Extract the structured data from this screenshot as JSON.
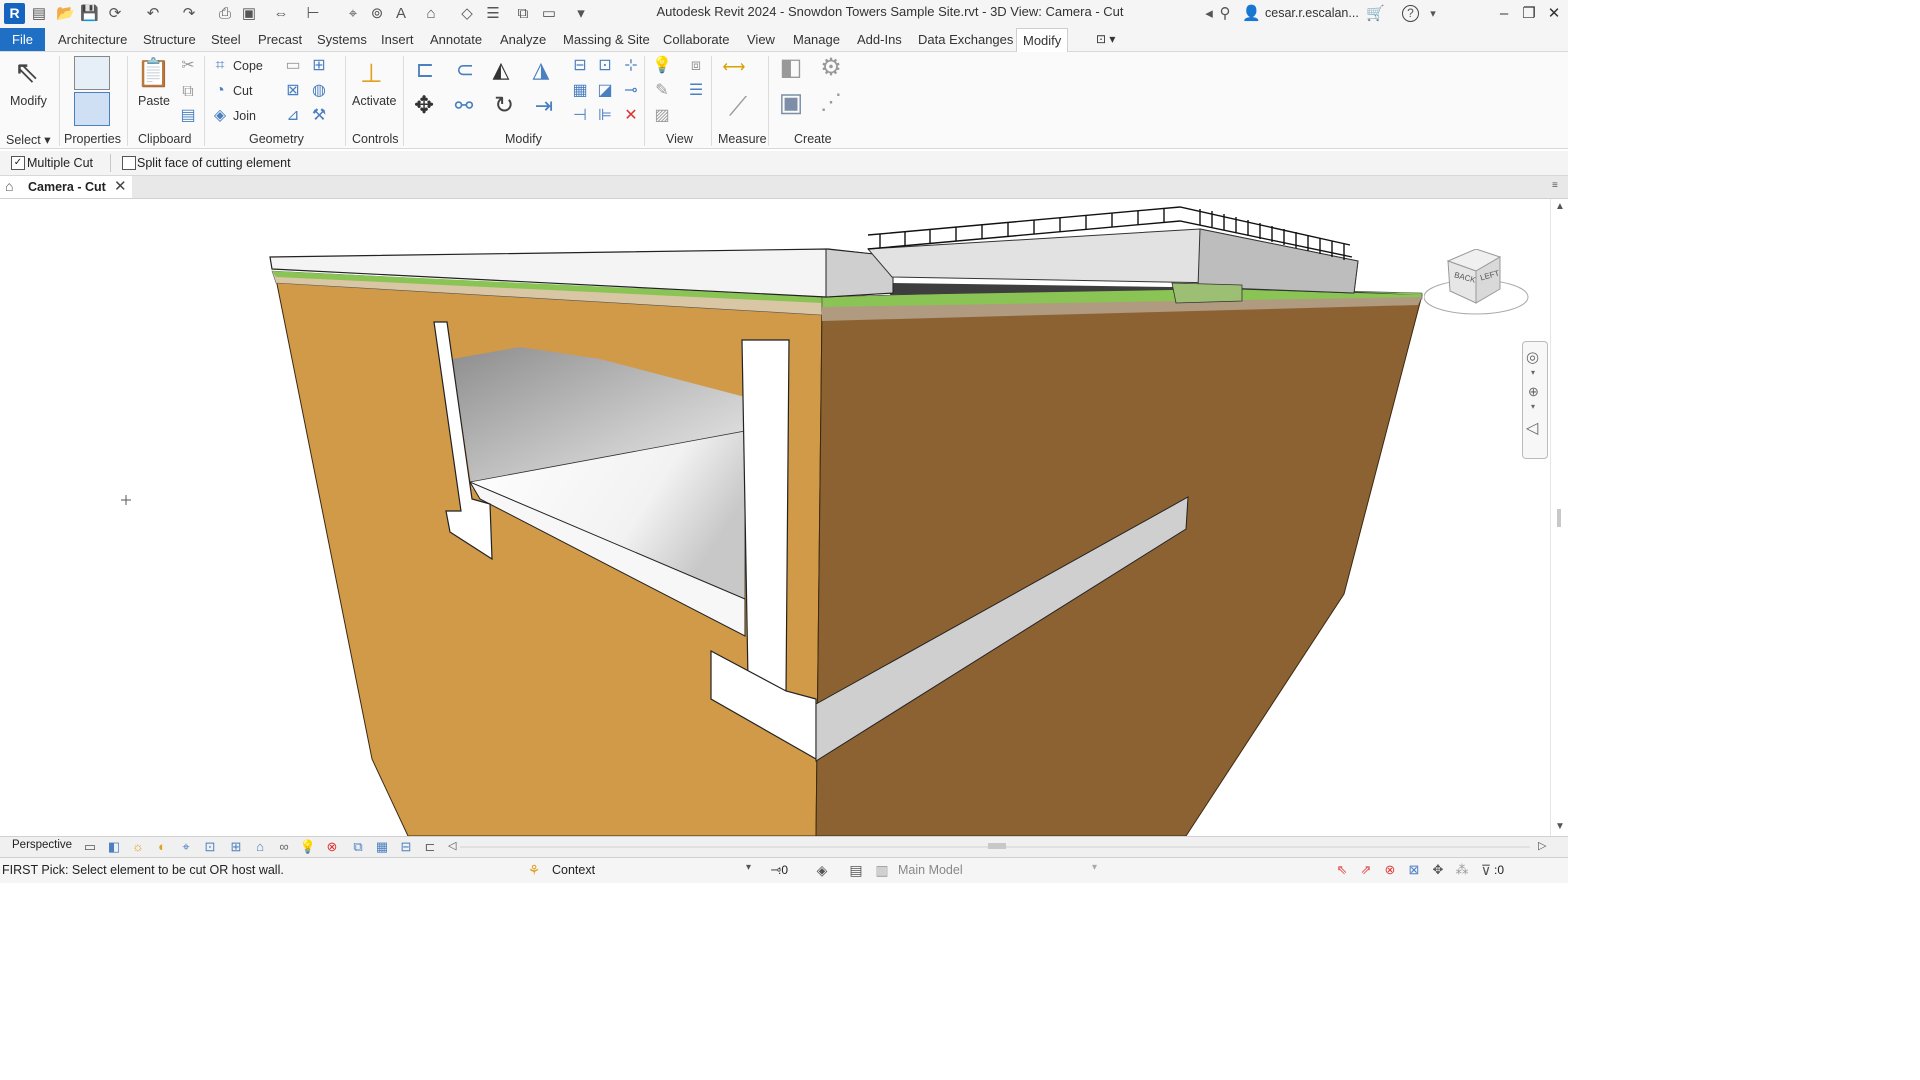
{
  "titlebar": {
    "app_logo": "R",
    "title": "Autodesk Revit 2024 - Snowdon Towers Sample Site.rvt - 3D View: Camera - Cut",
    "user": "cesar.r.escalan...",
    "help": "?"
  },
  "tabs": [
    "File",
    "Architecture",
    "Structure",
    "Steel",
    "Precast",
    "Systems",
    "Insert",
    "Annotate",
    "Analyze",
    "Massing & Site",
    "Collaborate",
    "View",
    "Manage",
    "Add-Ins",
    "Data Exchanges",
    "Modify"
  ],
  "active_tab": "Modify",
  "ribbon": {
    "modify_label": "Modify",
    "paste_label": "Paste",
    "cope_label": "Cope",
    "cut_label": "Cut",
    "join_label": "Join",
    "activate_label": "Activate",
    "panels": {
      "select": "Select",
      "properties": "Properties",
      "clipboard": "Clipboard",
      "geometry": "Geometry",
      "controls": "Controls",
      "modify": "Modify",
      "view": "View",
      "measure": "Measure",
      "create": "Create"
    }
  },
  "options_bar": {
    "multiple_cut_label": "Multiple Cut",
    "multiple_cut_checked": true,
    "split_face_label": "Split face of cutting element",
    "split_face_checked": false
  },
  "view_tab": {
    "label": "Camera - Cut"
  },
  "viewcube": {
    "back": "BACK",
    "left": "LEFT"
  },
  "view_control": {
    "mode": "Perspective"
  },
  "status_bar": {
    "prompt": "FIRST Pick: Select element to be cut OR host wall.",
    "workset": "Context",
    "selection_count": ":0",
    "model": "Main Model",
    "filter_count": ":0"
  },
  "colors": {
    "file_tab": "#1f6fc5",
    "soil_front": "#d09a48",
    "soil_side": "#8c6232",
    "grass": "#8ac455"
  }
}
